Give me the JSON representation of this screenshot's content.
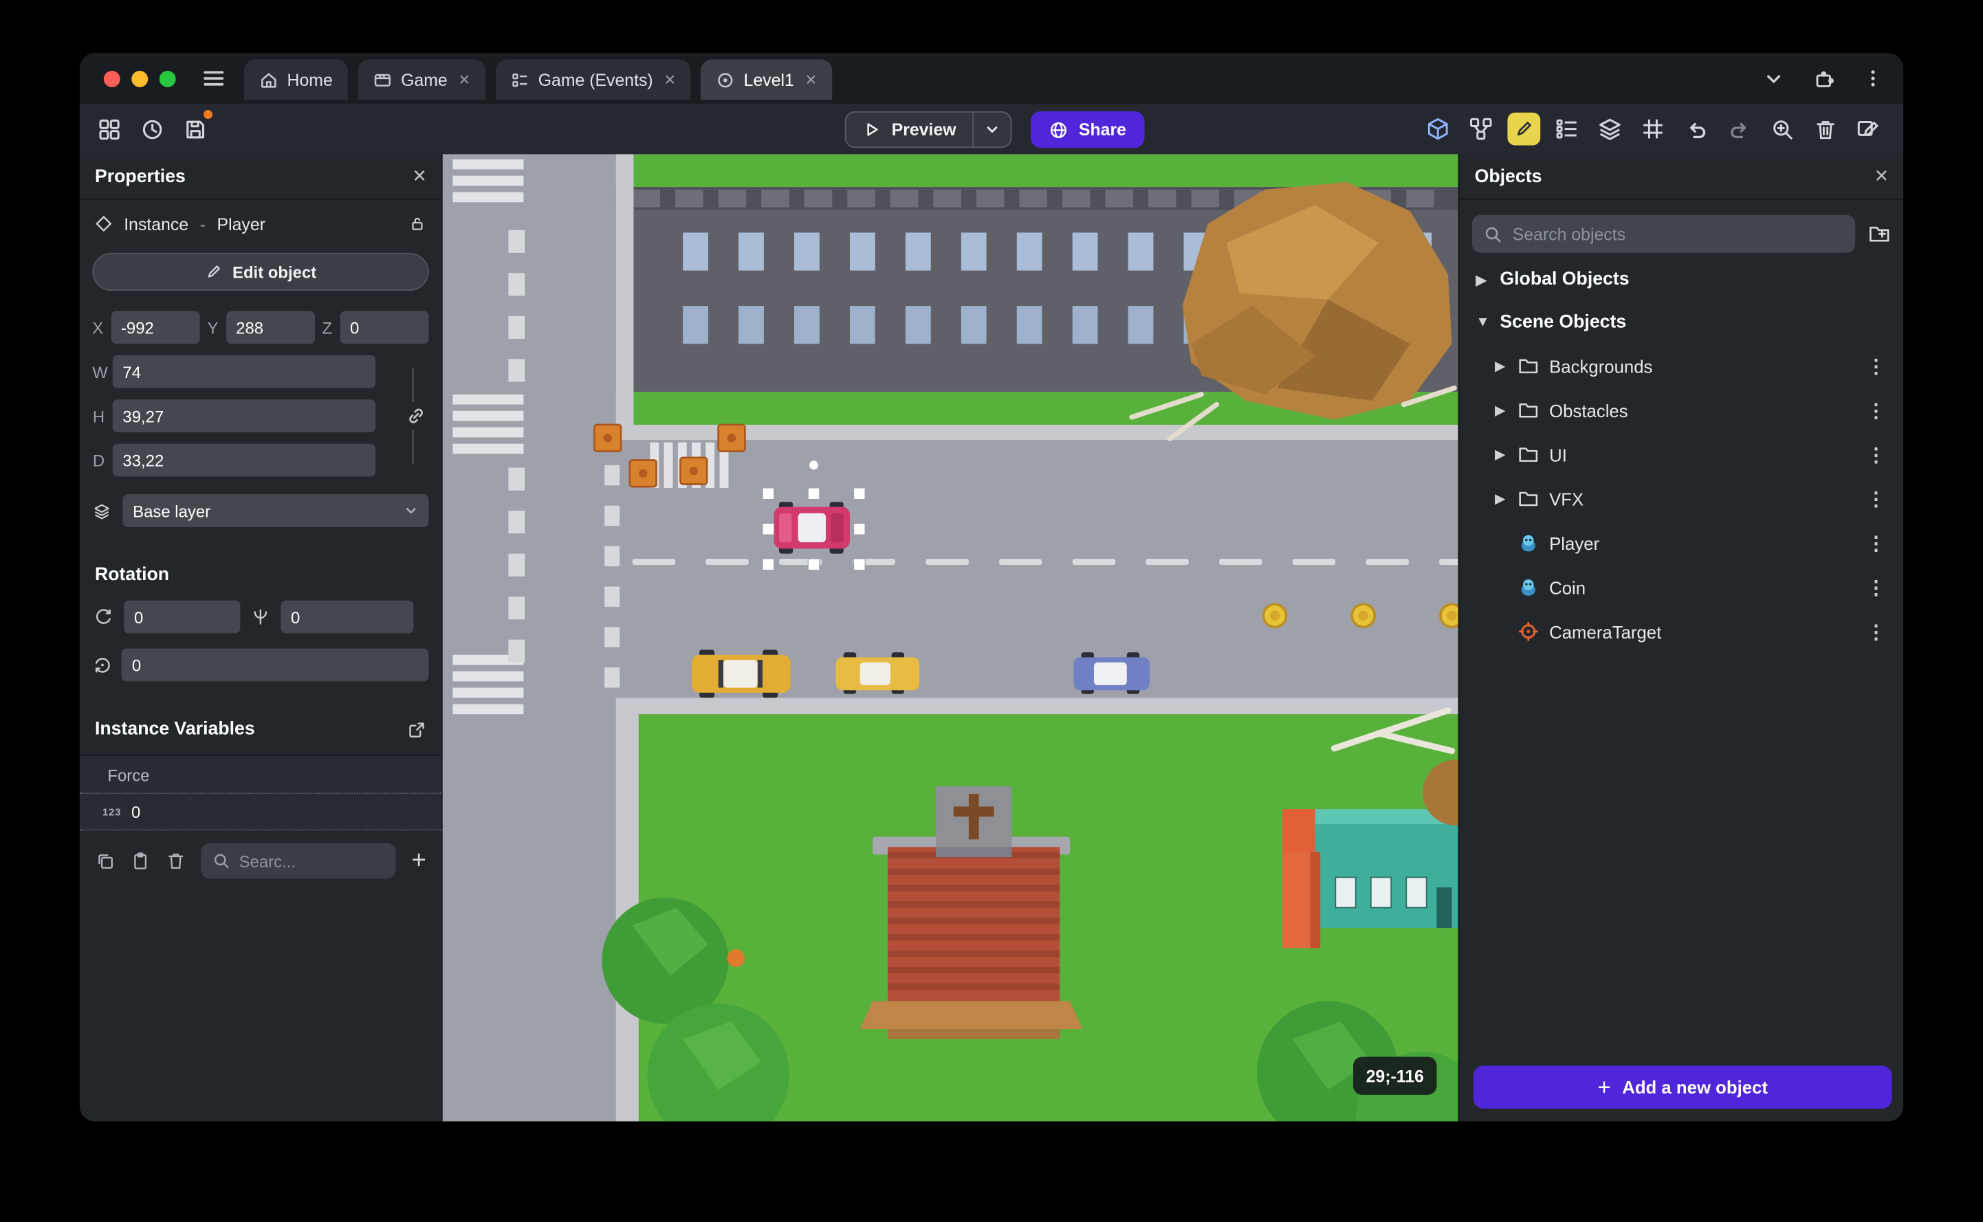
{
  "titlebar": {
    "tabs": [
      {
        "label": "Home"
      },
      {
        "label": "Game"
      },
      {
        "label": "Game (Events)"
      },
      {
        "label": "Level1"
      }
    ]
  },
  "toolbar": {
    "preview_label": "Preview",
    "share_label": "Share"
  },
  "properties": {
    "title": "Properties",
    "instance_type": "Instance",
    "separator": "-",
    "instance_name": "Player",
    "edit_object_label": "Edit object",
    "x_label": "X",
    "x_value": "-992",
    "y_label": "Y",
    "y_value": "288",
    "z_label": "Z",
    "z_value": "0",
    "w_label": "W",
    "w_value": "74",
    "h_label": "H",
    "h_value": "39,27",
    "d_label": "D",
    "d_value": "33,22",
    "layer_value": "Base layer",
    "rotation_title": "Rotation",
    "rotation_x": "0",
    "rotation_y": "0",
    "rotation_z": "0",
    "instance_variables_title": "Instance Variables",
    "variable_name": "Force",
    "variable_type": "123",
    "variable_value": "0",
    "variables_search_placeholder": "Searc..."
  },
  "objects_panel": {
    "title": "Objects",
    "search_placeholder": "Search objects",
    "sections": {
      "global": "Global Objects",
      "scene": "Scene Objects"
    },
    "folders": [
      "Backgrounds",
      "Obstacles",
      "UI",
      "VFX"
    ],
    "objects": [
      {
        "name": "Player"
      },
      {
        "name": "Coin"
      },
      {
        "name": "CameraTarget"
      }
    ],
    "add_button_label": "Add a new object"
  },
  "canvas": {
    "coords_badge": "29;-116"
  },
  "colors": {
    "accent_purple": "#4f26d9",
    "active_tool_yellow": "#e8d44d",
    "cube_tool_blue": "#8fb2ff",
    "traffic_red": "#ff5f57",
    "traffic_yellow": "#febc2e",
    "traffic_green": "#28c840",
    "selection_handle": "#ffffff"
  }
}
